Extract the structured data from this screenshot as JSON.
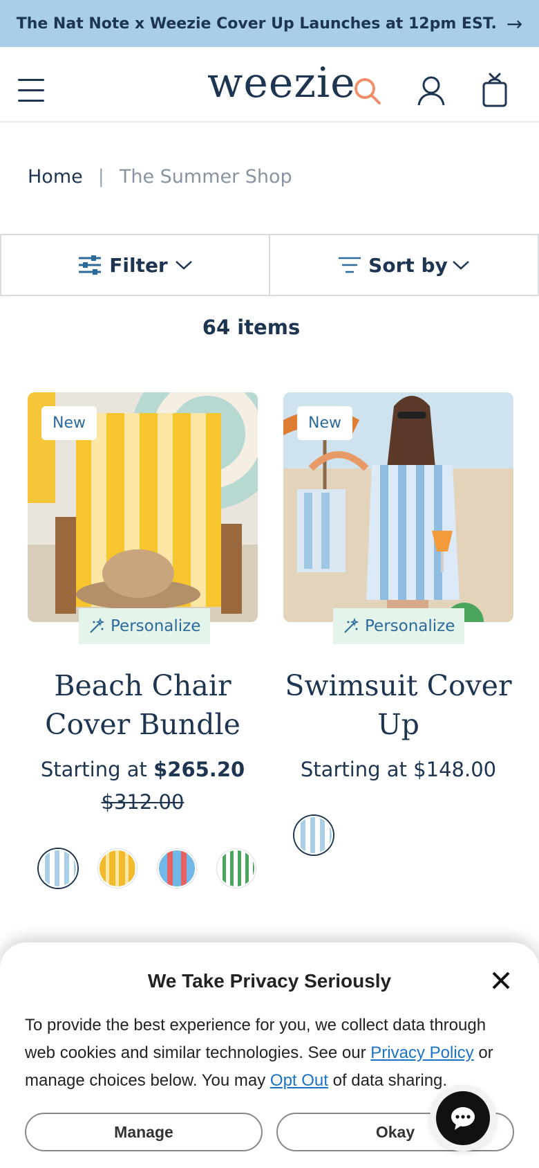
{
  "announcement": {
    "text": "The Nat Note x Weezie Cover Up Launches at 12pm EST.",
    "arrow": "→"
  },
  "header": {
    "logo": "weezie",
    "icons": [
      "menu-icon",
      "search-icon",
      "account-icon",
      "gift-bag-icon"
    ],
    "accent_color": "#ef8f6b"
  },
  "breadcrumb": {
    "home": "Home",
    "separator": "|",
    "current": "The Summer Shop"
  },
  "toolbar": {
    "filter_label": "Filter",
    "sort_label": "Sort by"
  },
  "results": {
    "count_label": "64 items"
  },
  "products": [
    {
      "badge": "New",
      "personalize_label": "Personalize",
      "title_line1": "Beach Chair",
      "title_line2": "Cover Bundle",
      "price_prefix": "Starting at",
      "price": "$265.20",
      "original_price": "$312.00",
      "swatches": [
        "#cfe3f5",
        "#f2bb2c",
        "#e66161",
        "#4aa55d"
      ]
    },
    {
      "badge": "New",
      "personalize_label": "Personalize",
      "title_line1": "Swimsuit Cover",
      "title_line2": "Up",
      "price_prefix": "Starting at",
      "price": "$148.00",
      "swatches": [
        "#cfe3f5"
      ]
    }
  ],
  "privacy": {
    "title": "We Take Privacy Seriously",
    "text_part1": "To provide the best experience for you, we collect data through web cookies and similar technologies. See our ",
    "privacy_link": "Privacy Policy",
    "text_part2": " or manage choices below. You may ",
    "opt_out_link": "Opt Out",
    "text_part3": " of data sharing.",
    "manage_label": "Manage",
    "okay_label": "Okay"
  },
  "colors": {
    "navy": "#1d3550",
    "banner": "#a9cfe8",
    "personalize_bg": "#e4f4ea",
    "link": "#1a73c8"
  }
}
